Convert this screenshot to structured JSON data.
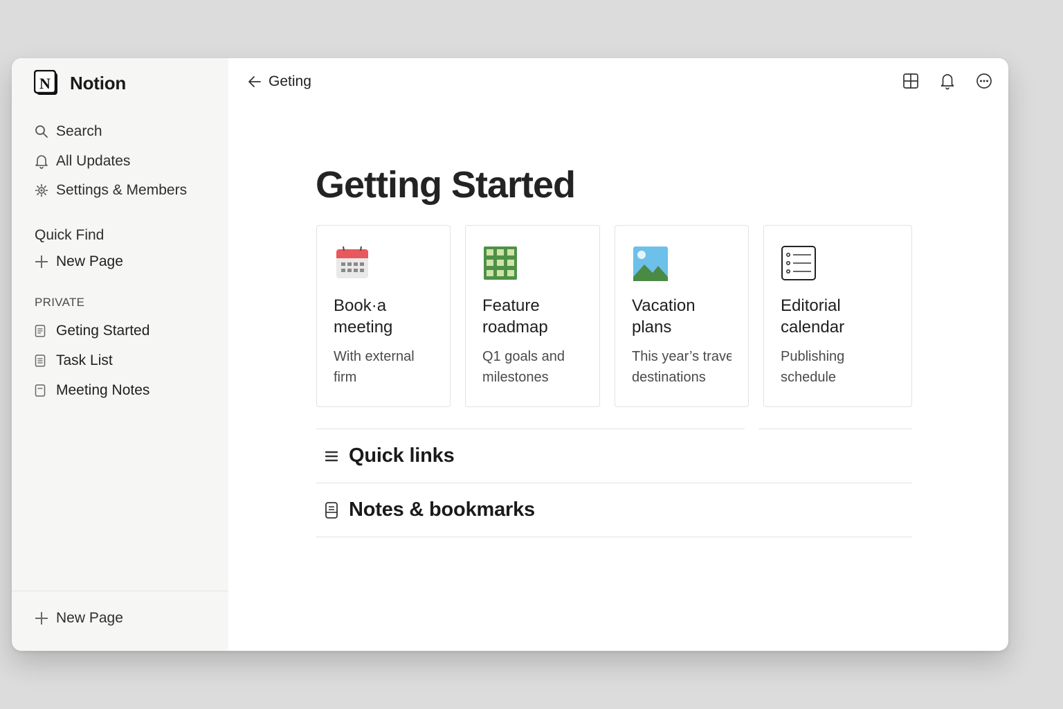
{
  "app": {
    "name": "Notion"
  },
  "sidebar": {
    "nav": [
      {
        "label": "Search",
        "icon": "search-icon"
      },
      {
        "label": "All Updates",
        "icon": "bell-icon"
      },
      {
        "label": "Settings & Members",
        "icon": "gear-icon"
      }
    ],
    "quick_find": "Quick Find",
    "new_page": "New Page",
    "section_label": "PRIVATE",
    "pages": [
      {
        "label": "Geting Started"
      },
      {
        "label": "Task List"
      },
      {
        "label": "Meeting Notes"
      }
    ],
    "footer_new_page": "New Page"
  },
  "topbar": {
    "breadcrumb": "Geting",
    "actions": [
      "layout-grid-icon",
      "bell-icon",
      "more-icon"
    ]
  },
  "page": {
    "title": "Getting Started",
    "cards": [
      {
        "title": "Book·a\nmeeting",
        "desc": "With external\nfirm",
        "icon": "calendar-icon"
      },
      {
        "title": "Feature\nroadmap",
        "desc": "Q1 goals and\nmilestones",
        "icon": "table-grid-icon"
      },
      {
        "title": "Vacation\nplans",
        "desc": "This year’s travel\ndestinations",
        "icon": "image-icon"
      },
      {
        "title": "Editorial\ncalendar",
        "desc": "Publishing schedule",
        "icon": "checklist-icon"
      }
    ],
    "sections": [
      {
        "title": "Quick links",
        "icon": "list-icon"
      },
      {
        "title": "Notes & bookmarks",
        "icon": "notes-icon"
      }
    ]
  },
  "colors": {
    "sidebar_bg": "#f6f6f4",
    "calendar_red": "#e8585c",
    "roadmap_green": "#5aa04a",
    "vacation_sky": "#5fb7e8"
  }
}
